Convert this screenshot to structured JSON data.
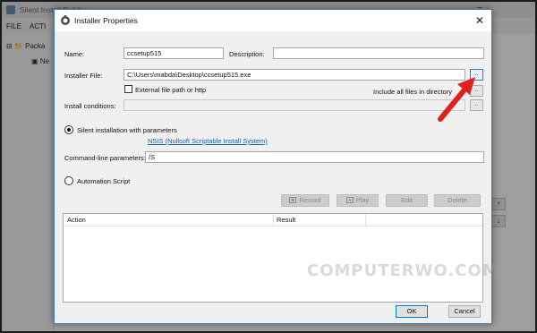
{
  "background_app": {
    "title": "Silent Install Builder",
    "menu": [
      "FILE",
      "ACTI"
    ],
    "tree": [
      "Packa",
      "Ne"
    ],
    "side_buttons": [
      "↑",
      "↓"
    ]
  },
  "dialog": {
    "title": "Installer Properties",
    "close_glyph": "✕",
    "name_label": "Name:",
    "name_value": "ccsetup515",
    "description_label": "Description:",
    "description_value": "",
    "installer_file_label": "Installer File:",
    "installer_file_value": "C:\\Users\\mabda\\Desktop\\ccsetup515.exe",
    "browse_label": "..",
    "external_path_label": "External file path or http",
    "include_all_label": "Include all files in directory",
    "include_btn_label": "..",
    "install_conditions_label": "Install conditions:",
    "install_conditions_value": "",
    "conditions_btn_label": "..",
    "silent_install_label": "Silent installation with parameters",
    "nsis_link": "NSIS (Nullsoft Scriptable Install System)",
    "cmdline_label": "Command-line parameters:",
    "cmdline_value": "/S",
    "automation_label": "Automation Script",
    "toolbar": {
      "record": "Record",
      "play": "Play",
      "edit": "Edit",
      "delete": "Delete"
    },
    "list_columns": [
      "Action",
      "Result"
    ],
    "ok_label": "OK",
    "cancel_label": "Cancel"
  },
  "watermark": "COMPUTERWO.COM",
  "colors": {
    "annotation_arrow": "#e0201a",
    "link": "#1a5ea8",
    "accent_border": "#3d7ab8"
  },
  "icons": [
    "installer-icon",
    "close-icon",
    "record-icon",
    "play-icon",
    "red-arrow-annotation"
  ]
}
